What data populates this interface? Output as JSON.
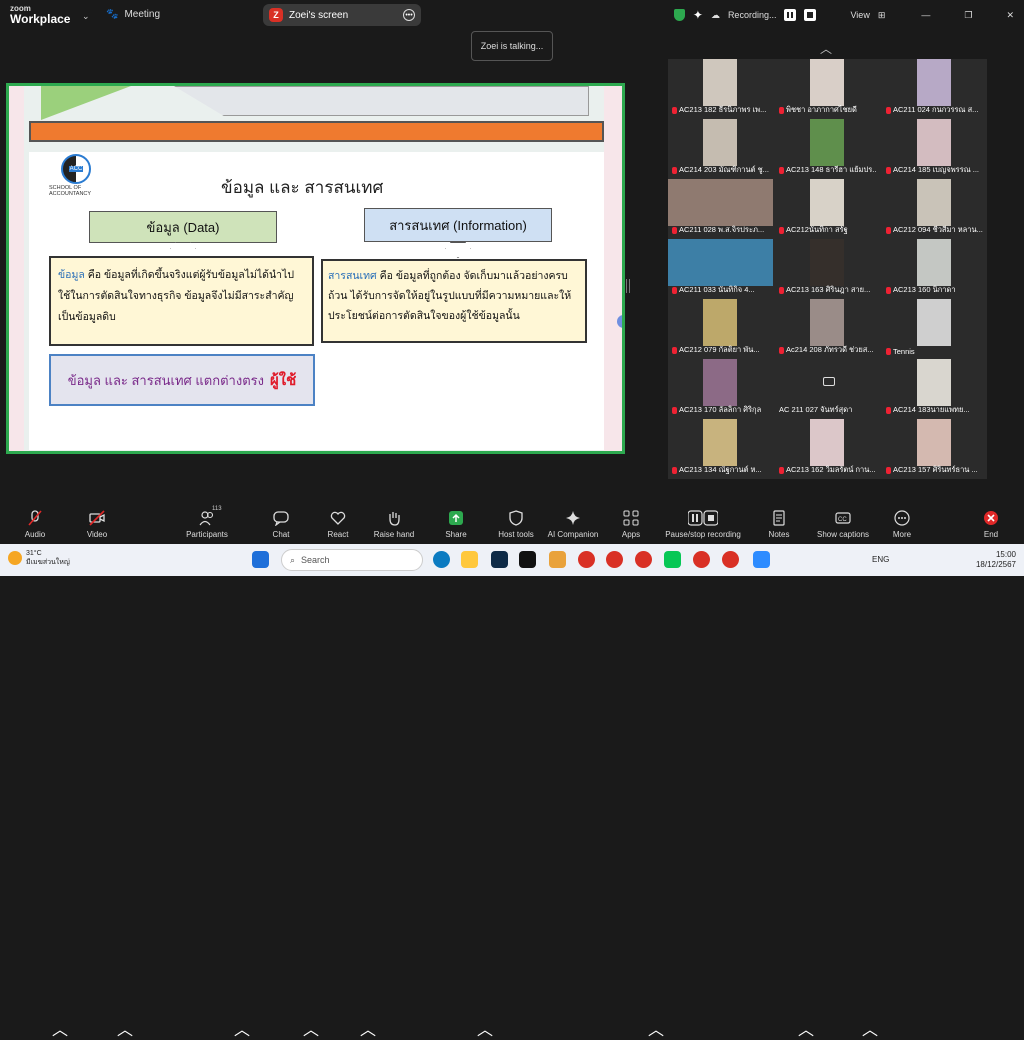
{
  "app": {
    "logo_top": "zoom",
    "logo_bottom": "Workplace",
    "meeting_label": "Meeting"
  },
  "screen_share": {
    "label": "Zoei's screen",
    "badge": "Z"
  },
  "recording": {
    "status": "Recording...",
    "view_label": "View"
  },
  "talking_toast": "Zoei is talking...",
  "slide": {
    "logo_caption": "SCHOOL OF ACCOUNTANCY",
    "logo_initials": "ACC",
    "title": "ข้อมูล และ สารสนเทศ",
    "data_header": "ข้อมูล (Data)",
    "info_header": "สารสนเทศ (Information)",
    "data_def_term": "ข้อมูล",
    "data_def_text": " คือ ข้อมูลที่เกิดขึ้นจริงแต่ผู้รับข้อมูลไม่ได้นำไปใช้ในการตัดสินใจทางธุรกิจ ข้อมูลจึงไม่มีสาระสำคัญ เป็นข้อมูลดิบ",
    "info_def_term": "สารสนเทศ",
    "info_def_text": " คือ ข้อมูลที่ถูกต้อง จัดเก็บมาแล้วอย่างครบถ้วน ได้รับการจัดให้อยู่ในรูปแบบที่มีความหมายและให้ประโยชน์ต่อการตัดสินใจของผู้ใช้ข้อมูลนั้น",
    "diff_text": "ข้อมูล และ สารสนเทศ แตกต่างตรง",
    "diff_highlight": "ผู้ใช้"
  },
  "participants": [
    {
      "name": "AC213 182 ธีรนิภาพร เพ...",
      "muted": true,
      "bg": "#cfc7bd"
    },
    {
      "name": "พิชชา อาภากาศไชยดี",
      "muted": true,
      "bg": "#d9cfc8"
    },
    {
      "name": "AC211 024 กนกวรรณ ส...",
      "muted": true,
      "bg": "#b7a9c6"
    },
    {
      "name": "AC214 203 มัณฑิกานต์ ชู...",
      "muted": true,
      "bg": "#c5bcb0"
    },
    {
      "name": "AC213 148 ธารีฮา แย้มปร...",
      "muted": true,
      "bg": "#5f8f4c"
    },
    {
      "name": "AC214 185 เบญจพรรณ ...",
      "muted": true,
      "bg": "#d3bcc0"
    },
    {
      "name": "AC211 028 พ.ส.จิรประภ...",
      "muted": true,
      "bg": "#8f7a70"
    },
    {
      "name": "AC212นันทิกา สรัฐ",
      "muted": true,
      "bg": "#d8d2c8"
    },
    {
      "name": "AC212 094 ชีวสีมา หลาน...",
      "muted": true,
      "bg": "#c9c3b8"
    },
    {
      "name": "AC211 033 นันทิกิจ 4...",
      "muted": true,
      "bg": "#3d7fa6"
    },
    {
      "name": "AC213 163 ศิรินฎา สาย...",
      "muted": true,
      "bg": "#352f2b"
    },
    {
      "name": "AC213 160 นิกาดา",
      "muted": true,
      "bg": "#c4c7c3"
    },
    {
      "name": "AC212 079 กัลติยา พัน...",
      "muted": true,
      "bg": "#bda86a"
    },
    {
      "name": "Ac214 208 ภัทรวดี ช่วยส...",
      "muted": true,
      "bg": "#9a8c88"
    },
    {
      "name": "Tennis",
      "muted": true,
      "bg": "#cfcfcf"
    },
    {
      "name": "AC213 170 ลัลลิกา ศิริกุล",
      "muted": true,
      "bg": "#8c6a86"
    },
    {
      "name": "AC 211 027 จันทร์สุดา",
      "muted": false,
      "camoff": true,
      "bg": "#3a3a3a"
    },
    {
      "name": "AC214 183นายแพทย...",
      "muted": true,
      "bg": "#d9d6cf"
    },
    {
      "name": "AC213 134 ณัฐกานต์ ห...",
      "muted": true,
      "bg": "#c8b37e"
    },
    {
      "name": "AC213 162 วิมลรัตน์ กาน...",
      "muted": true,
      "bg": "#dcc7c9"
    },
    {
      "name": "AC213 157 ศิรินทร์ธาน ...",
      "muted": true,
      "bg": "#d4b9b0"
    }
  ],
  "toolbar": {
    "audio": "Audio",
    "video": "Video",
    "participants": "Participants",
    "participants_count": "113",
    "chat": "Chat",
    "react": "React",
    "raise_hand": "Raise hand",
    "share": "Share",
    "host_tools": "Host tools",
    "ai_companion": "AI Companion",
    "apps": "Apps",
    "pause_stop": "Pause/stop recording",
    "notes": "Notes",
    "captions": "Show captions",
    "more": "More",
    "end": "End"
  },
  "taskbar": {
    "temp": "31°C",
    "weather": "มีเมฆส่วนใหญ่",
    "search": "Search",
    "lang": "ENG",
    "time": "15:00",
    "date": "18/12/2567"
  },
  "colors": {
    "share_border": "#2da94f",
    "orange_bar": "#ef7a2f",
    "end_red": "#e02828"
  }
}
